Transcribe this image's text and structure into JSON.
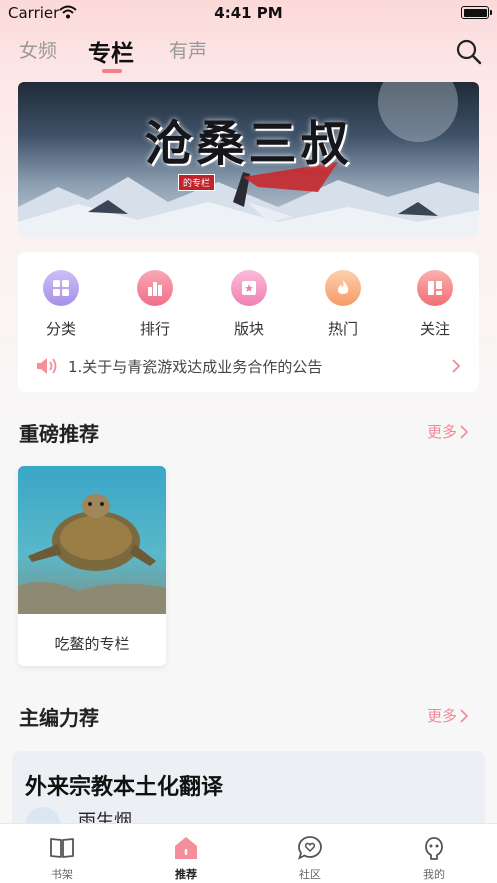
{
  "status_bar": {
    "carrier": "Carrier",
    "time": "4:41 PM"
  },
  "header": {
    "tabs": [
      {
        "label": "女频",
        "active": false
      },
      {
        "label": "专栏",
        "active": true
      },
      {
        "label": "有声",
        "active": false
      }
    ]
  },
  "banner": {
    "title": "沧桑三叔",
    "subtitle": "的专栏"
  },
  "quick_menu": [
    {
      "label": "分类",
      "icon": "grid-icon",
      "color": "#b9a8f0"
    },
    {
      "label": "排行",
      "icon": "bar-chart-icon",
      "color": "#f58da0"
    },
    {
      "label": "版块",
      "icon": "star-card-icon",
      "color": "#f6a0c6"
    },
    {
      "label": "热门",
      "icon": "flame-icon",
      "color": "#f8b48a"
    },
    {
      "label": "关注",
      "icon": "layout-icon",
      "color": "#f59293"
    }
  ],
  "notice": {
    "text": "1.关于与青瓷游戏达成业务合作的公告"
  },
  "featured": {
    "title": "重磅推荐",
    "more": "更多",
    "books": [
      {
        "name": "吃鳌的专栏"
      }
    ]
  },
  "editor_picks": {
    "title": "主编力荐",
    "more": "更多",
    "card": {
      "title": "外来宗教本土化翻译",
      "author": "雨生烟"
    }
  },
  "tab_bar": [
    {
      "label": "书架",
      "icon": "book-icon",
      "active": false
    },
    {
      "label": "推荐",
      "icon": "home-icon",
      "active": true
    },
    {
      "label": "社区",
      "icon": "chat-heart-icon",
      "active": false
    },
    {
      "label": "我的",
      "icon": "ghost-icon",
      "active": false
    }
  ],
  "colors": {
    "accent": "#f27f8b",
    "more_link": "#f08a96"
  }
}
